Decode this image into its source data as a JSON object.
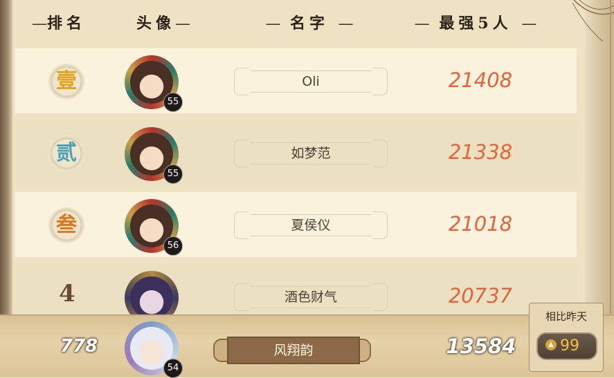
{
  "header": {
    "col_rank": "排名",
    "col_avatar": "头像",
    "col_name": "名字",
    "col_power": "最强5人",
    "dash": "—"
  },
  "rows": [
    {
      "rank_label": "壹",
      "rank_color": "#e3a41c",
      "level": "55",
      "name": "Oli",
      "power": "21408"
    },
    {
      "rank_label": "贰",
      "rank_color": "#4aa1b5",
      "level": "55",
      "name": "如梦范",
      "power": "21338"
    },
    {
      "rank_label": "叁",
      "rank_color": "#e0791d",
      "level": "56",
      "name": "夏侯仪",
      "power": "21018"
    },
    {
      "rank_label": "4",
      "rank_color": "#6a4a36",
      "level": "",
      "name": "酒色财气",
      "power": "20737"
    }
  ],
  "self": {
    "rank": "778",
    "level": "54",
    "name": "风翔韵",
    "power": "13584"
  },
  "compare": {
    "label": "相比昨天",
    "arrow_icon": "up-arrow-icon",
    "value": "99"
  }
}
